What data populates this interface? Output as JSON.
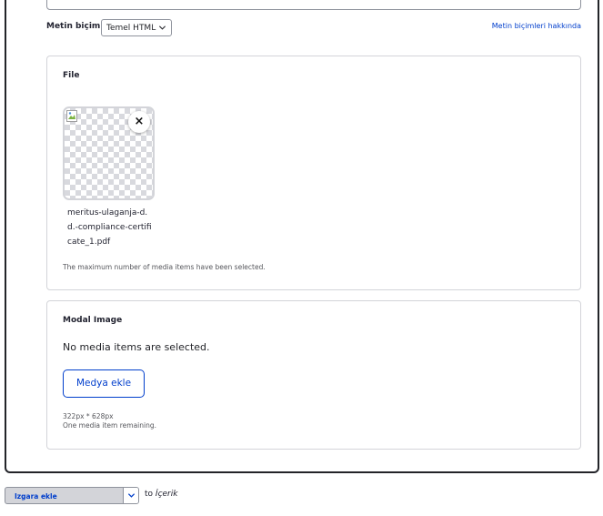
{
  "text_format": {
    "label": "Metin biçimi",
    "selected": "Temel HTML",
    "help_link": "Metin biçimleri hakkında"
  },
  "file_field": {
    "title": "File",
    "media_item": {
      "filename": "meritus-ulaganja-d.d.-compliance-certificate_1.pdf"
    },
    "remove_label": "×",
    "description": "The maximum number of media items have been selected."
  },
  "modal_image_field": {
    "title": "Modal Image",
    "empty_message": "No media items are selected.",
    "add_button": "Medya ekle",
    "dimensions": "322px * 628px",
    "remaining": "One media item remaining."
  },
  "add_grid": {
    "selected": "Izgara ekle",
    "to_prefix": "to",
    "target": "İçerik"
  },
  "colors": {
    "accent": "#003ecc",
    "border": "#d3d4d9",
    "text": "#222330"
  }
}
